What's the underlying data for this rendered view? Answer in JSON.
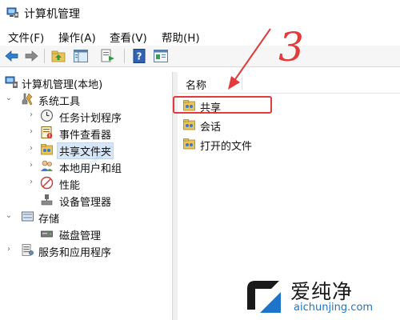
{
  "window": {
    "title": "计算机管理",
    "app_icon": "computer-management-icon"
  },
  "menu": {
    "file": "文件(F)",
    "action": "操作(A)",
    "view": "查看(V)",
    "help": "帮助(H)"
  },
  "toolbar": {
    "buttons": [
      "back-arrow-icon",
      "forward-arrow-icon",
      "up-folder-icon",
      "show-hide-tree-icon",
      "export-list-icon",
      "help-icon",
      "properties-pane-icon"
    ]
  },
  "tree": {
    "root": "计算机管理(本地)",
    "system_tools": "系统工具",
    "task_scheduler": "任务计划程序",
    "event_viewer": "事件查看器",
    "shared_folders": "共享文件夹",
    "local_users": "本地用户和组",
    "performance": "性能",
    "device_manager": "设备管理器",
    "storage": "存储",
    "disk_management": "磁盘管理",
    "services": "服务和应用程序"
  },
  "list": {
    "column_name": "名称",
    "items": [
      "共享",
      "会话",
      "打开的文件"
    ]
  },
  "annotation": {
    "number": "3",
    "color": "#e23b3b"
  },
  "watermark": {
    "cn": "爱纯净",
    "url": "aichunjing.com",
    "diagonal": "aichunjing.com"
  },
  "colors": {
    "selected_bg": "#d9e6f6",
    "highlight": "#e23b3b",
    "brand_blue": "#1e74c8"
  }
}
